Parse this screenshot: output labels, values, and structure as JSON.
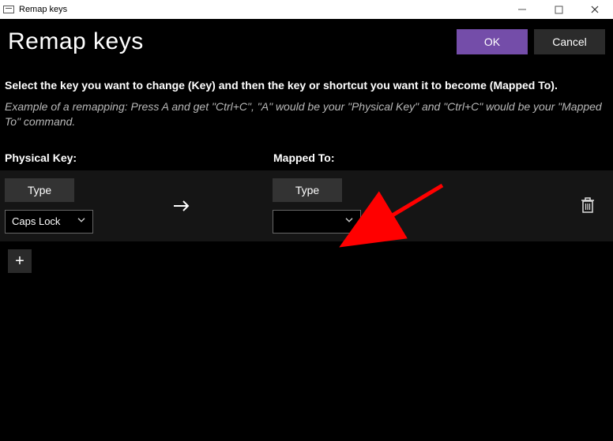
{
  "window": {
    "title": "Remap keys"
  },
  "header": {
    "page_title": "Remap keys",
    "ok_label": "OK",
    "cancel_label": "Cancel"
  },
  "text": {
    "instruction": "Select the key you want to change (Key) and then the key or shortcut you want it to become (Mapped To).",
    "example": "Example of a remapping: Press A and get \"Ctrl+C\", \"A\" would be your \"Physical Key\" and \"Ctrl+C\" would be your \"Mapped To\" command."
  },
  "columns": {
    "physical": "Physical Key:",
    "mapped": "Mapped To:"
  },
  "row": {
    "type_label": "Type",
    "physical_value": "Caps Lock",
    "mapped_value": ""
  },
  "icons": {
    "add": "+",
    "chevron": "˅"
  }
}
